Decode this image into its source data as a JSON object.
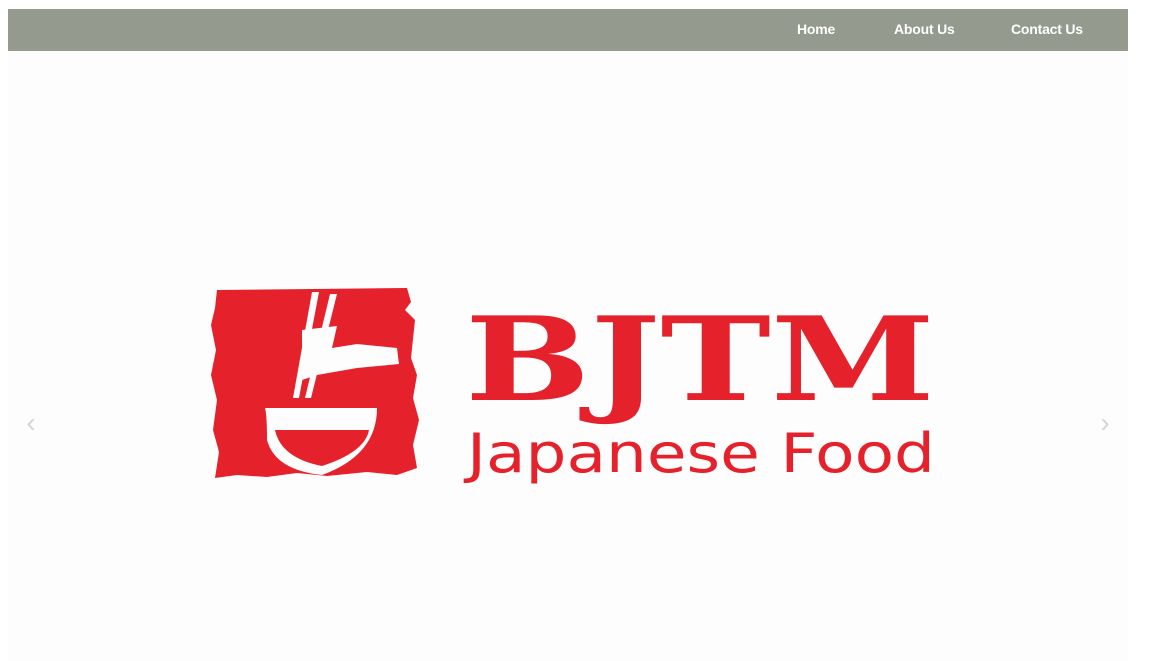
{
  "nav": {
    "home": "Home",
    "about": "About Us",
    "contact": "Contact Us"
  },
  "slider": {
    "prev_icon": "chevron-left-icon",
    "next_icon": "chevron-right-icon",
    "prev_glyph": "‹",
    "next_glyph": "›"
  },
  "logo": {
    "name": "BJTM",
    "tagline": "Japanese Food",
    "emblem_icon": "bowl-chopsticks-icon"
  },
  "colors": {
    "navbar": "#949a8e",
    "nav_text": "#ffffff",
    "brand_red": "#e5212b",
    "slider_bg": "#fdfdfd",
    "arrow": "#d6d6d6"
  }
}
